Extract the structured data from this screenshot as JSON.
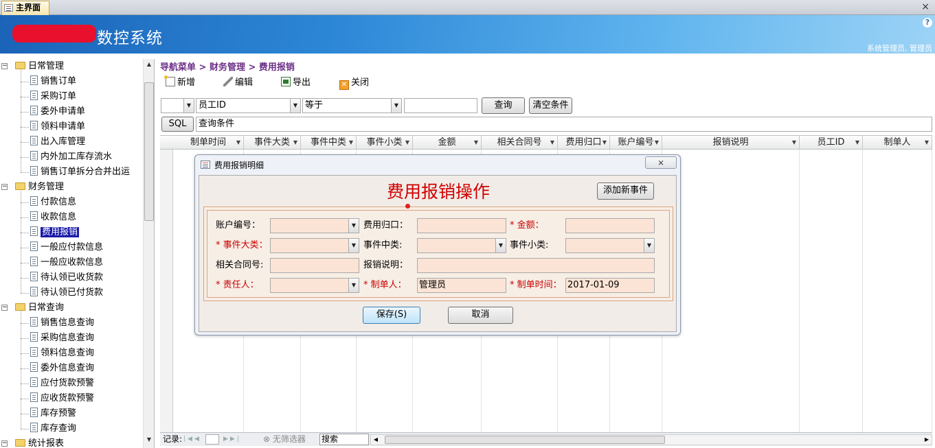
{
  "tab": {
    "label": "主界面",
    "close": "×"
  },
  "header": {
    "title": "数控系统",
    "help": "?",
    "user": "系统管理员, 管理员"
  },
  "nav": {
    "groups": [
      {
        "label": "日常管理",
        "items": [
          "销售订单",
          "采购订单",
          "委外申请单",
          "领料申请单",
          "出入库管理",
          "内外加工库存流水",
          "销售订单拆分合并出运"
        ]
      },
      {
        "label": "财务管理",
        "items": [
          "付款信息",
          "收款信息",
          "费用报销",
          "一般应付款信息",
          "一般应收款信息",
          "待认领已收货款",
          "待认领已付货款"
        ]
      },
      {
        "label": "日常查询",
        "items": [
          "销售信息查询",
          "采购信息查询",
          "领料信息查询",
          "委外信息查询",
          "应付货款预警",
          "应收货款预警",
          "库存预警",
          "库存查询"
        ]
      },
      {
        "label": "统计报表",
        "items": []
      }
    ],
    "selected": "费用报销"
  },
  "breadcrumb": "导航菜单 > 财务管理 > 费用报销",
  "toolbar": {
    "new": "新增",
    "edit": "编辑",
    "export": "导出",
    "close": "关闭"
  },
  "filter": {
    "field_value": "员工ID",
    "operator_value": "等于",
    "query_button": "查询",
    "clear_button": "清空条件",
    "sql_button": "SQL",
    "condition_label": "查询条件"
  },
  "grid": {
    "columns": [
      "制单时间",
      "事件大类",
      "事件中类",
      "事件小类",
      "金额",
      "相关合同号",
      "费用归口",
      "账户编号",
      "报销说明",
      "员工ID",
      "制单人"
    ]
  },
  "statusbar": {
    "record_label": "记录:",
    "filter_label": "无筛选器",
    "search": "搜索"
  },
  "dialog": {
    "window_title": "费用报销明细",
    "close": "⨯",
    "heading": "费用报销操作",
    "add_event_button": "添加新事件",
    "labels": {
      "account_no": "账户编号：",
      "expense_dept": "费用归口：",
      "amount": "* 金额：",
      "event_major": "* 事件大类：",
      "event_middle": "事件中类:",
      "event_minor": "事件小类:",
      "contract_no": "相关合同号:",
      "description": "报销说明：",
      "responsible": "* 责任人：",
      "creator": "* 制单人：",
      "created_time": "* 制单时间："
    },
    "values": {
      "creator": "管理员",
      "created_time": "2017-01-09"
    },
    "save_button": "保存(S)",
    "cancel_button": "取消"
  }
}
